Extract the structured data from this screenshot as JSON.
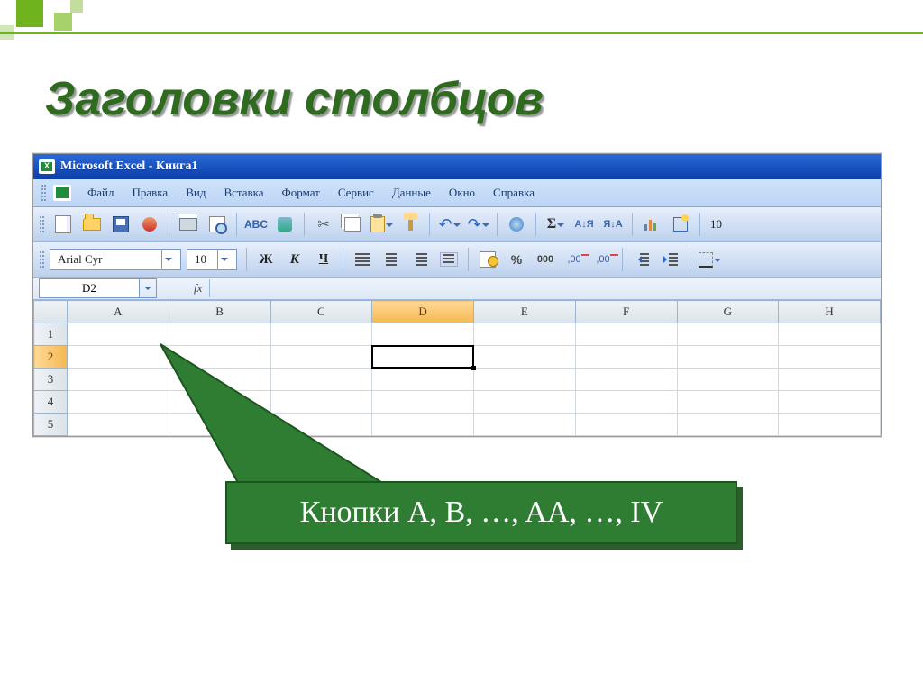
{
  "slide": {
    "title": "Заголовки столбцов"
  },
  "window": {
    "title": "Microsoft Excel - Книга1"
  },
  "menu": {
    "items": [
      "Файл",
      "Правка",
      "Вид",
      "Вставка",
      "Формат",
      "Сервис",
      "Данные",
      "Окно",
      "Справка"
    ]
  },
  "toolbar_std": {
    "spell_label": "ABC",
    "sum_label": "Σ",
    "sortA_label": "А↓Я",
    "sortZ_label": "Я↓А",
    "zoom_value": "10"
  },
  "toolbar_fmt": {
    "font_name": "Arial Cyr",
    "font_size": "10",
    "bold_label": "Ж",
    "italic_label": "К",
    "under_label": "Ч",
    "pct_label": "%",
    "sep_label": "000",
    "dec_inc": ",00",
    "dec_dec": ",00"
  },
  "namebox": {
    "ref": "D2"
  },
  "formula": {
    "fx_label": "fx"
  },
  "grid": {
    "columns": [
      "A",
      "B",
      "C",
      "D",
      "E",
      "F",
      "G",
      "H"
    ],
    "rows": [
      "1",
      "2",
      "3",
      "4",
      "5"
    ],
    "selected_col_index": 3,
    "selected_row_index": 1
  },
  "callout": {
    "text": "Кнопки A, B, …, AA, …, IV"
  }
}
